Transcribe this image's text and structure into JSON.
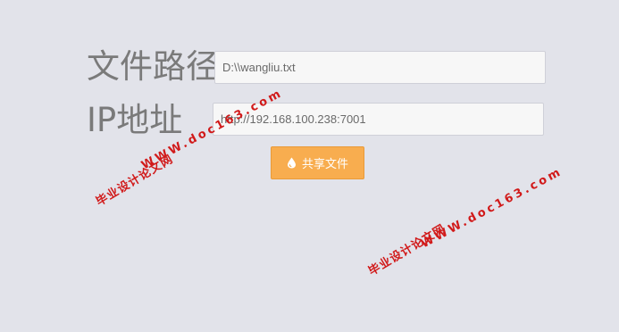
{
  "form": {
    "path_label": "文件路径",
    "path_value": "D:\\\\wangliu.txt",
    "ip_label": "IP地址",
    "ip_value": "http://192.168.100.238:7001",
    "share_button_label": "共享文件",
    "share_button_icon": "droplet-icon"
  },
  "watermarks": [
    {
      "url": "WWW.doc163.com",
      "text": "毕业设计论文网"
    },
    {
      "url": "WWW.doc163.com",
      "text": "毕业设计论文网"
    }
  ],
  "colors": {
    "background": "#e2e3ea",
    "button": "#f8ad4f",
    "watermark": "#d11a1a"
  }
}
